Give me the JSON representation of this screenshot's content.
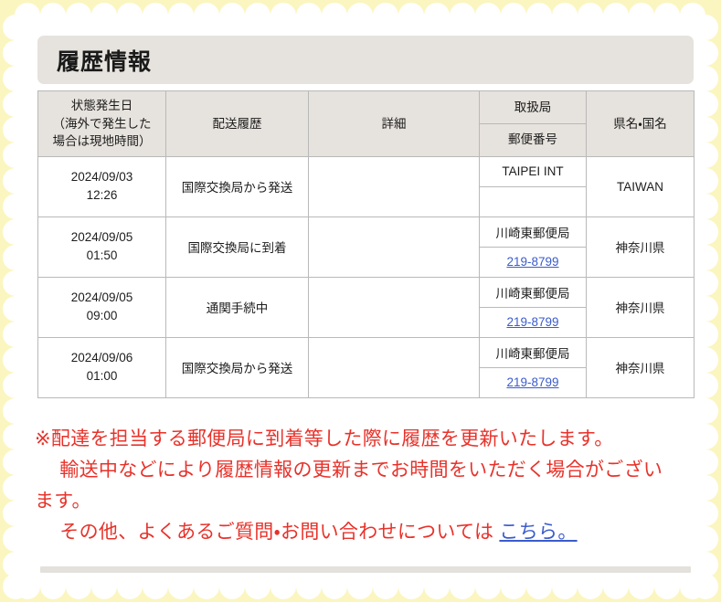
{
  "page": {
    "frame_color": "#fbf6c0",
    "card_color": "#ffffff",
    "accent_header_bg": "#e6e2dd",
    "link_color": "#3b5bcc",
    "notice_color": "#e8322a"
  },
  "section": {
    "title": "履歴情報"
  },
  "table": {
    "headers": {
      "date": "状態発生日\n（海外で発生した\n場合は現地時間）",
      "date_line1": "状態発生日",
      "date_line2": "（海外で発生した",
      "date_line3": "場合は現地時間）",
      "history": "配送履歴",
      "detail": "詳細",
      "office": "取扱局",
      "zip": "郵便番号",
      "prefecture": "県名・国名"
    },
    "rows": [
      {
        "date": "2024/09/03",
        "time": "12:26",
        "history": "国際交換局から発送",
        "detail": "",
        "office": "TAIPEI INT",
        "zip": "",
        "prefecture": "TAIWAN"
      },
      {
        "date": "2024/09/05",
        "time": "01:50",
        "history": "国際交換局に到着",
        "detail": "",
        "office": "川崎東郵便局",
        "zip": "219-8799",
        "prefecture": "神奈川県"
      },
      {
        "date": "2024/09/05",
        "time": "09:00",
        "history": "通関手続中",
        "detail": "",
        "office": "川崎東郵便局",
        "zip": "219-8799",
        "prefecture": "神奈川県"
      },
      {
        "date": "2024/09/06",
        "time": "01:00",
        "history": "国際交換局から発送",
        "detail": "",
        "office": "川崎東郵便局",
        "zip": "219-8799",
        "prefecture": "神奈川県"
      }
    ]
  },
  "notice": {
    "line1": "※配達を担当する郵便局に到着等した際に履歴を更新いたします。",
    "line2": "輸送中などにより履歴情報の更新までお時間をいただく場合がござい",
    "line3": "ます。",
    "line4_prefix": "その他、よくあるご質問・お問い合わせについては ",
    "line4_link": "こちら。"
  }
}
